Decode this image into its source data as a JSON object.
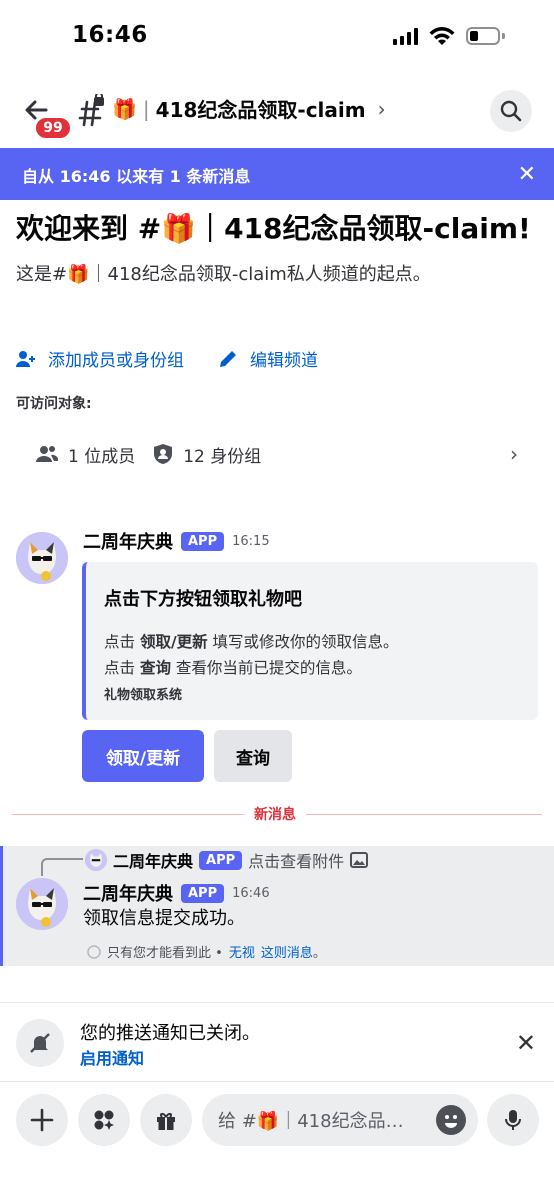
{
  "status_bar": {
    "time": "16:46"
  },
  "header": {
    "badge_count": "99",
    "channel_emoji": "🎁",
    "channel_name": "418纪念品领取-claim",
    "separator": "|",
    "chevron": "›"
  },
  "new_messages_banner": {
    "text": "自从 16:46 以来有 1 条新消息",
    "close": "✕"
  },
  "welcome": {
    "title": "欢迎来到 #🎁｜418纪念品领取-claim!",
    "subtitle": "这是#🎁｜418纪念品领取-claim私人频道的起点。",
    "add_members_label": "添加成员或身份组",
    "edit_channel_label": "编辑频道",
    "access_label": "可访问对象:",
    "members_count": "1 位成员",
    "roles_count": "12 身份组",
    "chevron": "›"
  },
  "message1": {
    "author": "二周年庆典",
    "tag": "APP",
    "time": "16:15",
    "embed": {
      "title": "点击下方按钮领取礼物吧",
      "line1_prefix": "点击 ",
      "line1_bold": "领取/更新",
      "line1_suffix": " 填写或修改你的领取信息。",
      "line2_prefix": "点击 ",
      "line2_bold": "查询",
      "line2_suffix": " 查看你当前已提交的信息。",
      "footer": "礼物领取系统"
    },
    "primary_button": "领取/更新",
    "secondary_button": "查询"
  },
  "divider_label": "新消息",
  "message2": {
    "reply_author": "二周年庆典",
    "reply_tag": "APP",
    "reply_text": "点击查看附件",
    "author": "二周年庆典",
    "tag": "APP",
    "time": "16:46",
    "content": "领取信息提交成功。",
    "ephemeral_text": "只有您才能看到此 •",
    "ephemeral_link1": "无视",
    "ephemeral_link2": "这则消息",
    "ephemeral_end": "。"
  },
  "notification": {
    "title": "您的推送通知已关闭。",
    "action": "启用通知",
    "close": "✕"
  },
  "composer": {
    "placeholder": "给 #🎁｜418纪念品…"
  }
}
